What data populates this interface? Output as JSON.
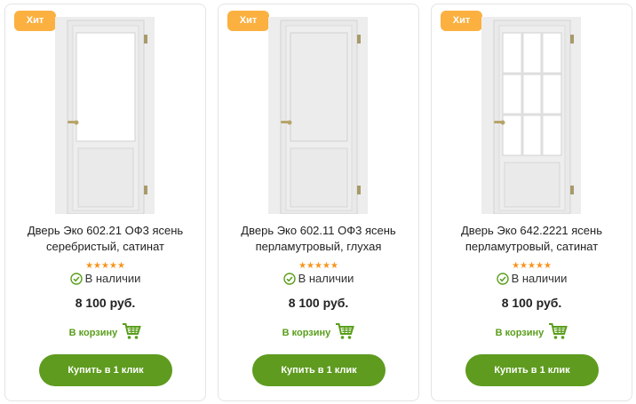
{
  "products": [
    {
      "badge": "Хит",
      "title": "Дверь Эко 602.21 ОФ3 ясень серебристый, сатинат",
      "rating": "★★★★★",
      "stock": "В наличии",
      "price": "8 100 руб.",
      "cart_label": "В корзину",
      "buy_label": "Купить в 1 клик",
      "door_style": "glass-top"
    },
    {
      "badge": "Хит",
      "title": "Дверь Эко 602.11 ОФ3 ясень перламутровый, глухая",
      "rating": "★★★★★",
      "stock": "В наличии",
      "price": "8 100 руб.",
      "cart_label": "В корзину",
      "buy_label": "Купить в 1 клик",
      "door_style": "solid"
    },
    {
      "badge": "Хит",
      "title": "Дверь Эко 642.2221 ясень перламутровый, сатинат",
      "rating": "★★★★★",
      "stock": "В наличии",
      "price": "8 100 руб.",
      "cart_label": "В корзину",
      "buy_label": "Купить в 1 клик",
      "door_style": "grid-glass"
    }
  ],
  "colors": {
    "badge": "#fbb040",
    "star": "#f7941d",
    "accent_green": "#5e9b1f",
    "cart_green": "#5a9e1c"
  },
  "icons": {
    "stock": "check-circle-icon",
    "cart": "shopping-cart-icon"
  }
}
